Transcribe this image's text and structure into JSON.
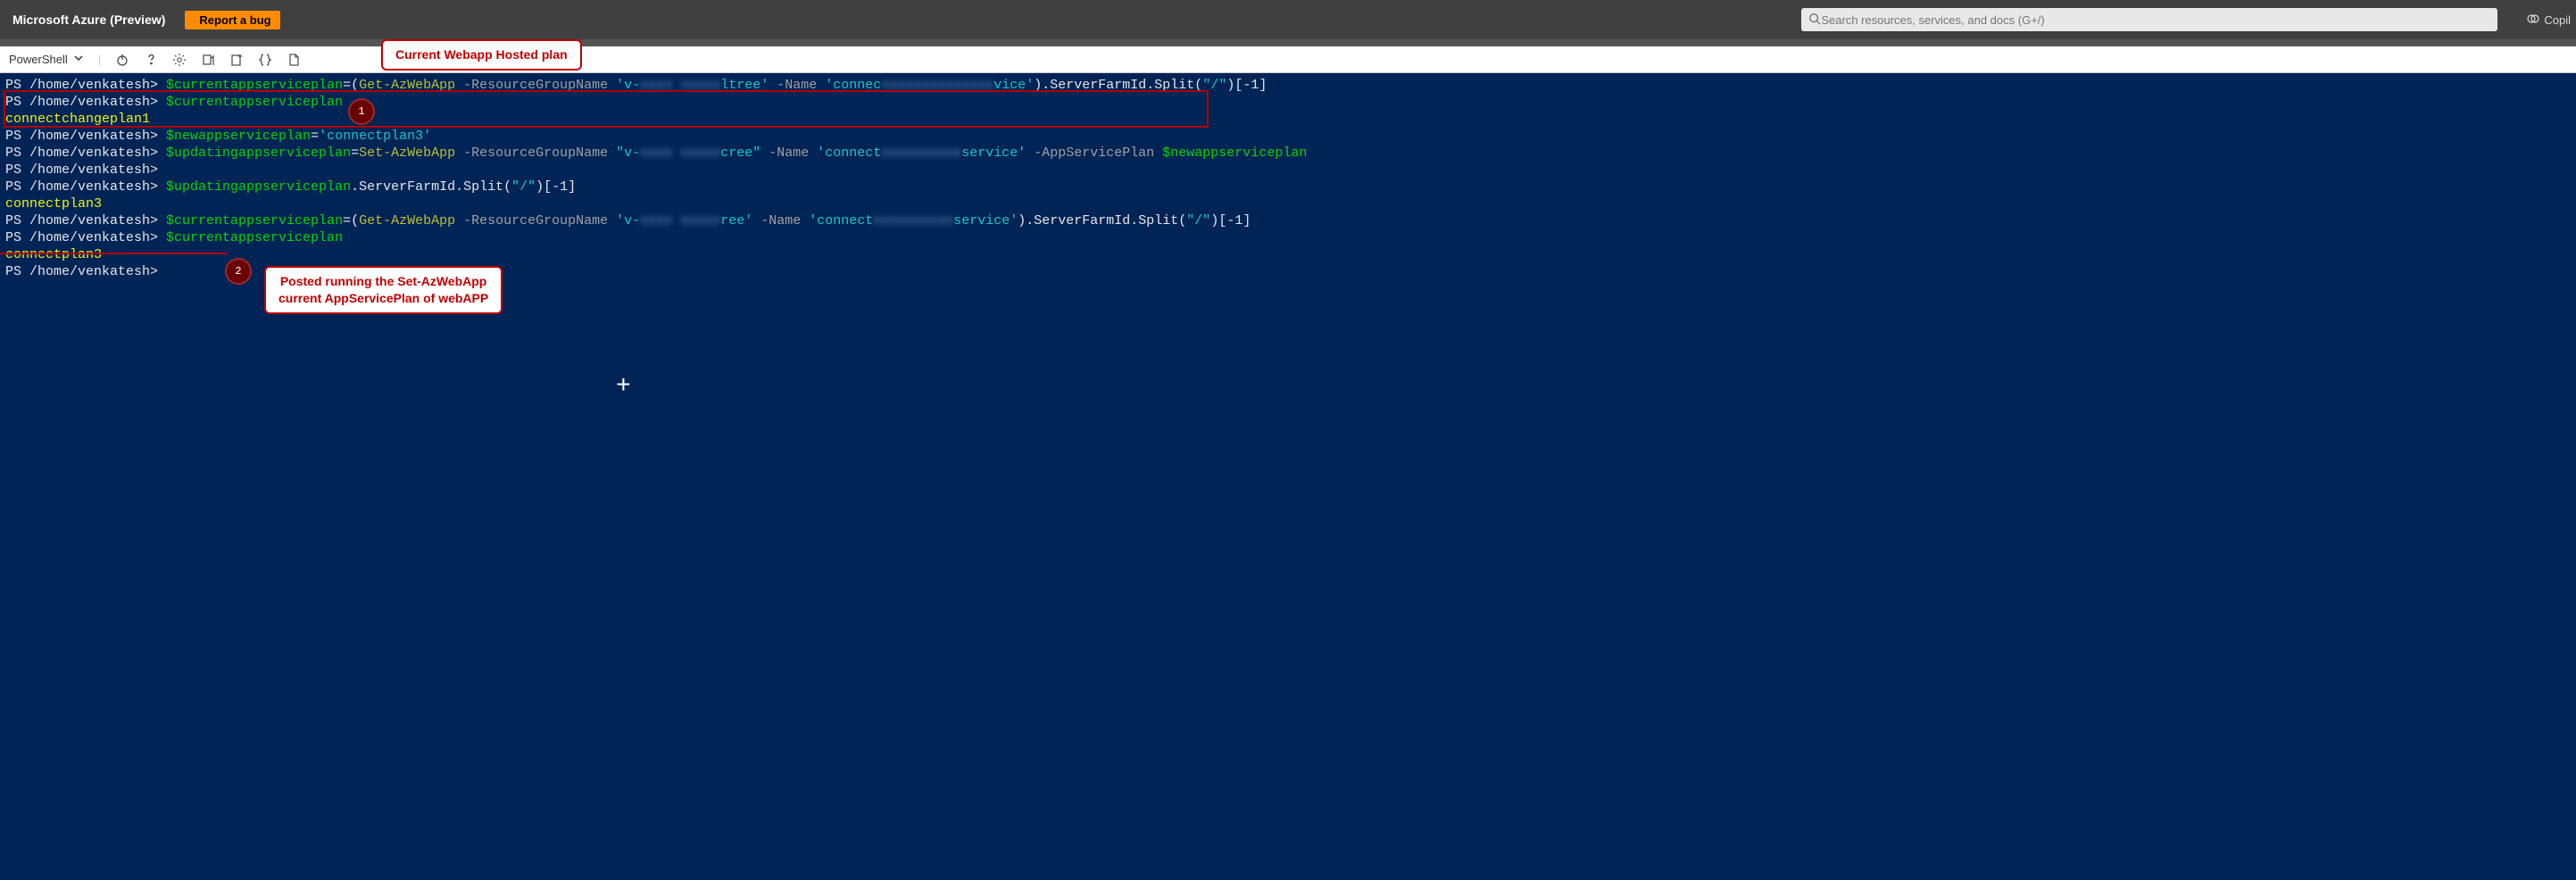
{
  "header": {
    "product": "Microsoft Azure (Preview)",
    "bug_button": "Report a bug",
    "search_placeholder": "Search resources, services, and docs (G+/)",
    "copilot": "Copil"
  },
  "shell": {
    "selector": "PowerShell"
  },
  "prompt": "PS /home/venkatesh>",
  "annotations": {
    "callout1": "Current Webapp Hosted plan",
    "callout2_l1": "Posted running the Set-AzWebApp",
    "callout2_l2": "current AppServicePlan of webAPP",
    "marker1": "1",
    "marker2": "2"
  },
  "lines": {
    "l1": {
      "prompt": "PS /home/venkatesh>",
      "var": " $currentappserviceplan",
      "eq": "=(",
      "cmd": "Get-AzWebApp",
      "p1": " -ResourceGroupName ",
      "v1a": "'v-",
      "v1mask": "xxxx xxxxx",
      "v1b": "ltree'",
      "p2": " -Name ",
      "v2a": "'connec",
      "v2mask": "xxxxxxxxxxxxxx",
      "v2b": "vice'",
      "tail": ").ServerFarmId.Split(",
      "slash": "\"/\"",
      "idx": ")[-1]"
    },
    "l2": {
      "prompt": "PS /home/venkatesh>",
      "var": " $currentappserviceplan"
    },
    "l3": {
      "out": "connectchangeplan1"
    },
    "l4": {
      "prompt": "PS /home/venkatesh>",
      "var": " $newappserviceplan",
      "eq": "=",
      "str": "'connectplan3'"
    },
    "l5": {
      "prompt": "PS /home/venkatesh>",
      "var": " $updatingappserviceplan",
      "eq": "=",
      "cmd": "Set-AzWebApp",
      "p1": " -ResourceGroupName ",
      "v1a": "\"v-",
      "v1mask": "xxxx xxxxx",
      "v1b": "cree\"",
      "p2": " -Name ",
      "v2a": "'connect",
      "v2mask": "xxxxxxxxxx",
      "v2b": "service'",
      "p3": " -AppServicePlan ",
      "var2": "$newappserviceplan"
    },
    "l6": {
      "prompt": "PS /home/venkatesh>"
    },
    "l7": {
      "prompt": "PS /home/venkatesh>",
      "var": " $updatingappserviceplan",
      "tail": ".ServerFarmId.Split(",
      "slash": "\"/\"",
      "idx": ")[-1]"
    },
    "l8": {
      "out": "connectplan3"
    },
    "l9": {
      "prompt": "PS /home/venkatesh>",
      "var": " $currentappserviceplan",
      "eq": "=(",
      "cmd": "Get-AzWebApp",
      "p1": " -ResourceGroupName ",
      "v1a": "'v-",
      "v1mask": "xxxx xxxxx",
      "v1b": "ree'",
      "p2": " -Name ",
      "v2a": "'connect",
      "v2mask": "xxxxxxxxxx",
      "v2b": "service'",
      "tail": ").ServerFarmId.Split(",
      "slash": "\"/\"",
      "idx": ")[-1]"
    },
    "l10": {
      "prompt": "PS /home/venkatesh>",
      "var": " $currentappserviceplan"
    },
    "l11": {
      "out": "connectplan3"
    },
    "l12": {
      "prompt": "PS /home/venkatesh>"
    }
  }
}
